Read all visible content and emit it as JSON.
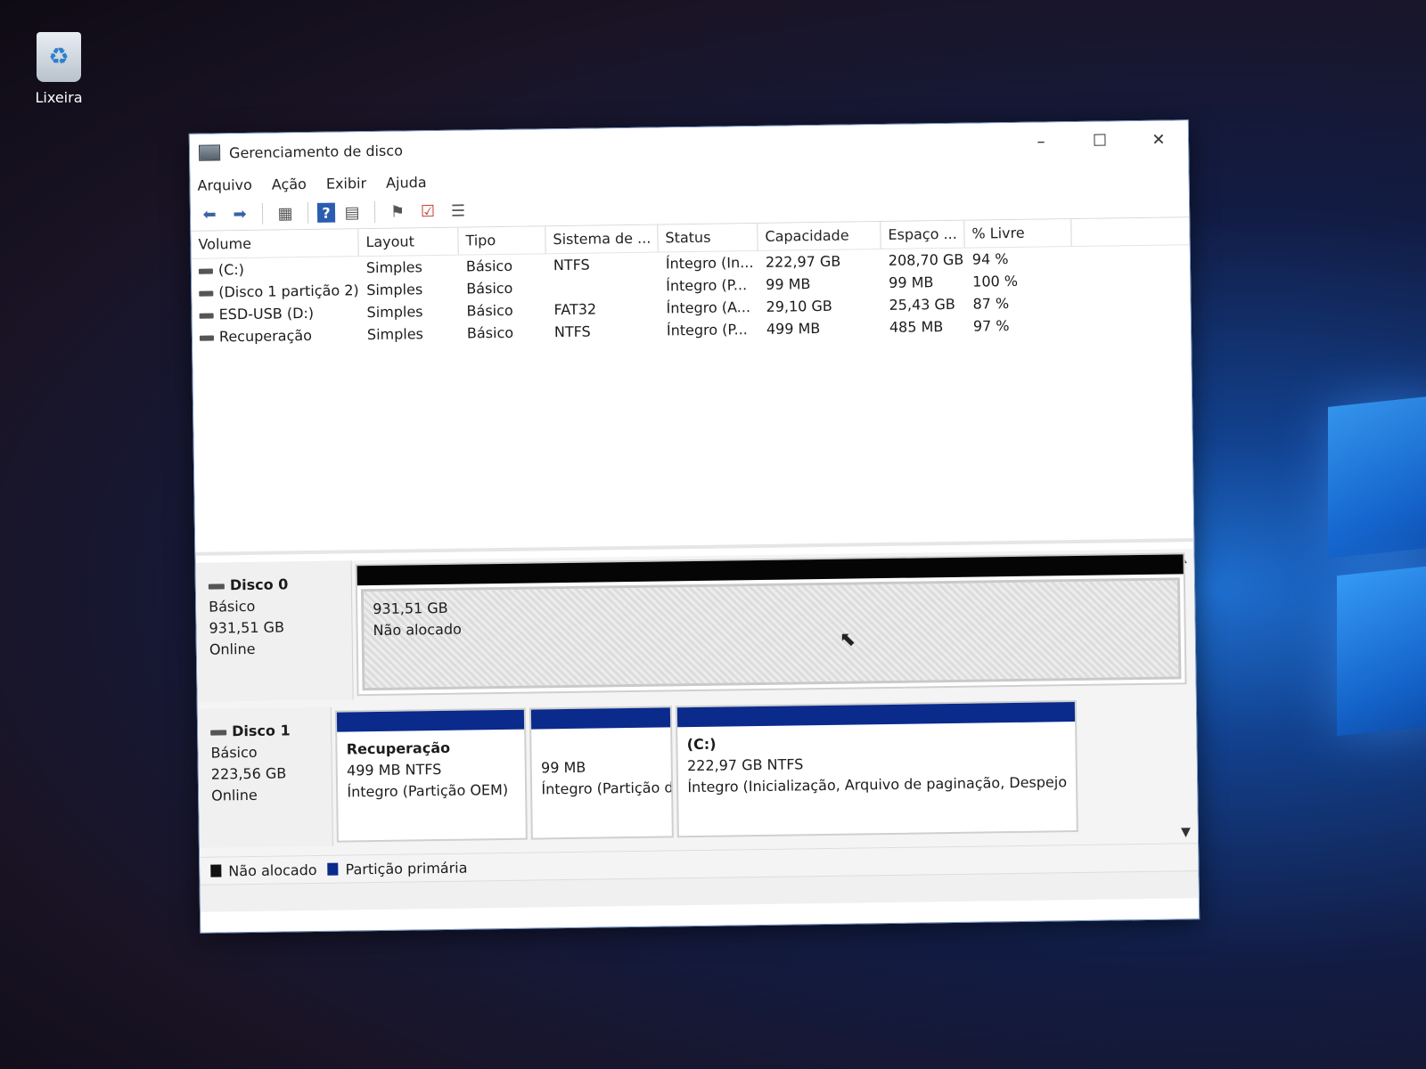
{
  "desktop": {
    "recycle_bin_label": "Lixeira"
  },
  "window": {
    "title": "Gerenciamento de disco",
    "minimize": "–",
    "maximize": "☐",
    "close": "✕"
  },
  "menu": [
    "Arquivo",
    "Ação",
    "Exibir",
    "Ajuda"
  ],
  "toolbar_icons": [
    "back-icon",
    "forward-icon",
    "console-tree-icon",
    "help-icon",
    "properties-icon",
    "connect-icon",
    "checklist-icon",
    "list-view-icon"
  ],
  "volumes": {
    "headers": [
      "Volume",
      "Layout",
      "Tipo",
      "Sistema de ...",
      "Status",
      "Capacidade",
      "Espaço ...",
      "% Livre"
    ],
    "rows": [
      [
        "(C:)",
        "Simples",
        "Básico",
        "NTFS",
        "Íntegro (In...",
        "222,97 GB",
        "208,70 GB",
        "94 %"
      ],
      [
        "(Disco 1 partição 2)",
        "Simples",
        "Básico",
        "",
        "Íntegro (P...",
        "99 MB",
        "99 MB",
        "100 %"
      ],
      [
        "ESD-USB (D:)",
        "Simples",
        "Básico",
        "FAT32",
        "Íntegro (A...",
        "29,10 GB",
        "25,43 GB",
        "87 %"
      ],
      [
        "Recuperação",
        "Simples",
        "Básico",
        "NTFS",
        "Íntegro (P...",
        "499 MB",
        "485 MB",
        "97 %"
      ]
    ]
  },
  "disks": [
    {
      "name": "Disco 0",
      "type": "Básico",
      "size": "931,51 GB",
      "state": "Online",
      "partitions": [
        {
          "title": "",
          "size": "931,51 GB",
          "status": "Não alocado"
        }
      ]
    },
    {
      "name": "Disco 1",
      "type": "Básico",
      "size": "223,56 GB",
      "state": "Online",
      "partitions": [
        {
          "title": "Recuperação",
          "size": "499 MB NTFS",
          "status": "Íntegro (Partição OEM)"
        },
        {
          "title": "",
          "size": "99 MB",
          "status": "Íntegro (Partição d"
        },
        {
          "title": "(C:)",
          "size": "222,97 GB NTFS",
          "status": "Íntegro (Inicialização, Arquivo de paginação, Despejo"
        }
      ]
    }
  ],
  "legend": [
    {
      "label": "Não alocado",
      "color": "#111111"
    },
    {
      "label": "Partição primária",
      "color": "#0a2a8c"
    }
  ],
  "colors": {
    "primary_partition": "#0a2a8c",
    "unallocated": "#050505"
  }
}
